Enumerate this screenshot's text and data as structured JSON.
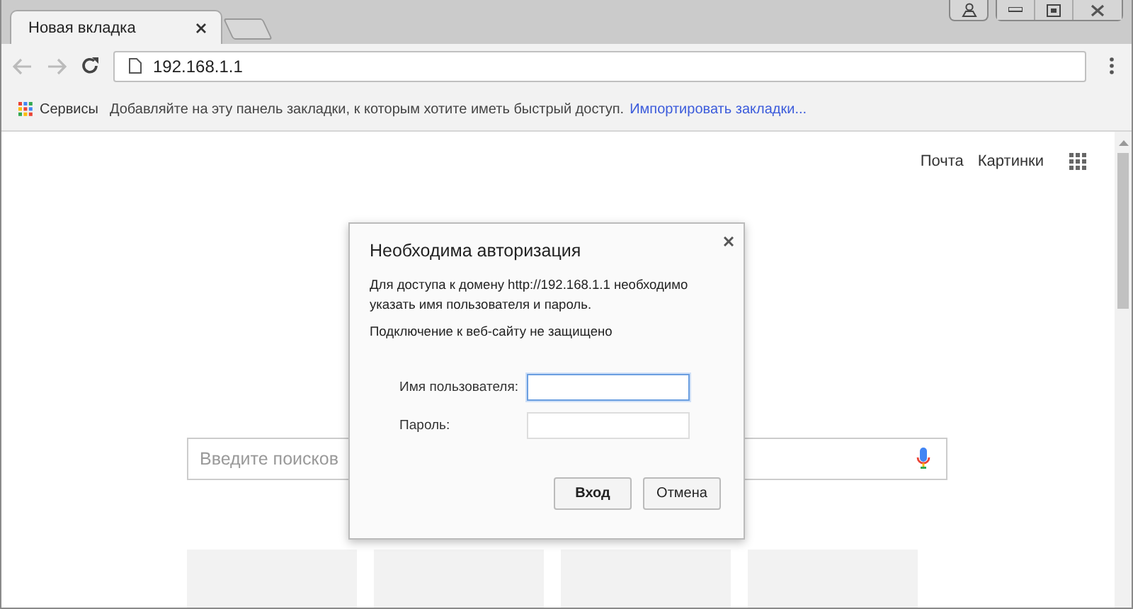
{
  "tabs": [
    {
      "title": "Новая вкладка",
      "selected": true
    }
  ],
  "address_bar": {
    "value": "192.168.1.1"
  },
  "bookmarks_bar": {
    "apps_label": "Сервисы",
    "hint": "Добавляйте на эту панель закладки, к которым хотите иметь быстрый доступ.",
    "import_link": "Импортировать закладки..."
  },
  "top_links": [
    "Почта",
    "Картинки"
  ],
  "search": {
    "placeholder": "Введите поисков"
  },
  "tiles": [
    {
      "kind": "empty"
    },
    {
      "kind": "empty"
    },
    {
      "kind": "empty"
    },
    {
      "kind": "empty"
    }
  ],
  "dialog": {
    "title": "Необходима авторизация",
    "message": "Для доступа к домену http://192.168.1.1 необходимо указать имя пользователя и пароль.",
    "warning": "Подключение к веб-сайту не защищено",
    "fields": [
      {
        "label": "Имя пользователя:",
        "focused": true
      },
      {
        "label": "Пароль:",
        "focused": false
      }
    ],
    "buttons": [
      {
        "label": "Вход",
        "default": true
      },
      {
        "label": "Отмена",
        "default": false
      }
    ]
  }
}
